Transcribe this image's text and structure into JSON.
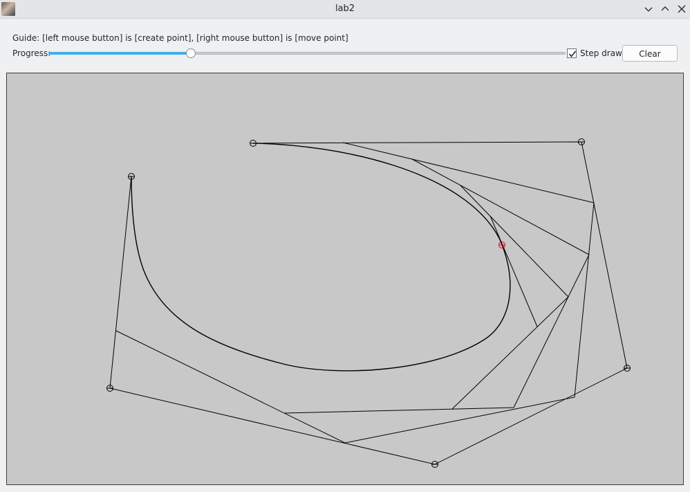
{
  "window": {
    "title": "lab2"
  },
  "guide": {
    "text": "Guide: [left mouse button] is [create point], [right mouse button] is [move point]"
  },
  "progress": {
    "label": "Progress:",
    "value": 0.275
  },
  "step_draw": {
    "label": "Step draw",
    "checked": true
  },
  "clear_button": {
    "label": "Clear"
  },
  "colors": {
    "curve": "#000000",
    "current_point": "#e0000f",
    "canvas_bg": "#c8c8c8",
    "accent": "#3daee9"
  }
}
